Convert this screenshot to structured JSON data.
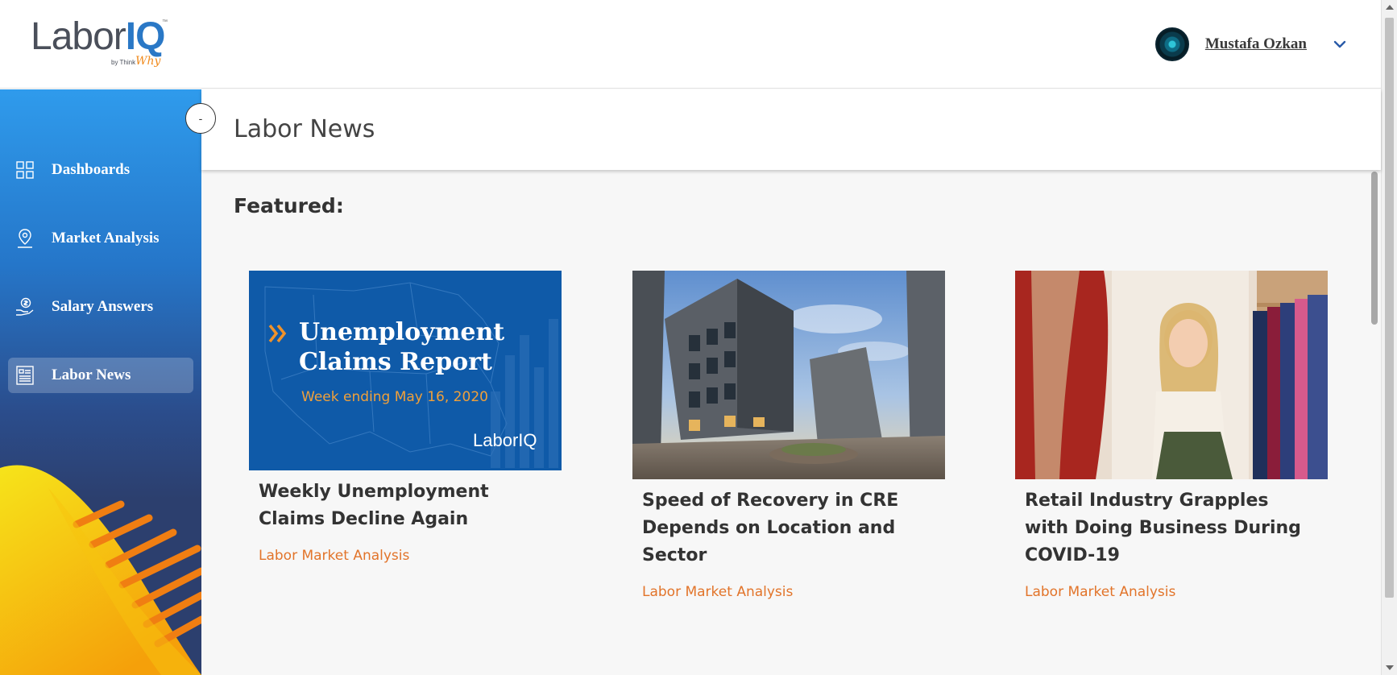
{
  "app": {
    "logo_main": "Labor",
    "logo_iq": "IQ",
    "logo_tm": "™",
    "logo_by": "by Think",
    "logo_why": "Why"
  },
  "user": {
    "name": "Mustafa Ozkan",
    "menu_icon": "chevron-down-icon"
  },
  "sidebar": {
    "collapse_label": "-",
    "items": [
      {
        "label": "Dashboards",
        "icon": "dashboard-grid-icon",
        "active": false
      },
      {
        "label": "Market Analysis",
        "icon": "map-pin-icon",
        "active": false
      },
      {
        "label": "Salary Answers",
        "icon": "money-hand-icon",
        "active": false
      },
      {
        "label": "Labor News",
        "icon": "newspaper-icon",
        "active": true
      }
    ]
  },
  "page": {
    "title": "Labor News",
    "section_heading": "Featured:"
  },
  "cards": [
    {
      "image_heading_line1": "Unemployment",
      "image_heading_line2": "Claims Report",
      "image_subheading": "Week ending May 16, 2020",
      "image_logo": "LaborIQ",
      "title": "Weekly Unemployment Claims Decline Again",
      "category": "Labor Market Analysis"
    },
    {
      "title": "Speed of Recovery in CRE Depends on Location and Sector",
      "category": "Labor Market Analysis"
    },
    {
      "title": "Retail Industry Grapples with Doing Business During COVID-19",
      "category": "Labor Market Analysis"
    }
  ],
  "colors": {
    "accent_orange": "#e2742a",
    "brand_blue": "#2a78c6",
    "sidebar_top": "#2f9bec",
    "sidebar_bottom": "#2c3f6e"
  }
}
